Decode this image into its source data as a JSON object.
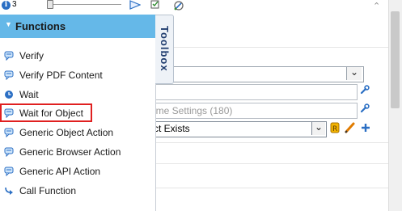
{
  "toolbar": {
    "info_count": "3"
  },
  "flyout": {
    "title": "Functions",
    "tab_label": "Toolbox",
    "items": [
      {
        "label": "Verify",
        "icon": "speech-bubble-icon"
      },
      {
        "label": "Verify PDF Content",
        "icon": "speech-bubble-icon"
      },
      {
        "label": "Wait",
        "icon": "clock-icon"
      },
      {
        "label": "Wait for Object",
        "icon": "speech-bubble-icon",
        "highlighted": true
      },
      {
        "label": "Generic Object Action",
        "icon": "speech-bubble-icon"
      },
      {
        "label": "Generic Browser Action",
        "icon": "speech-bubble-icon"
      },
      {
        "label": "Generic API Action",
        "icon": "speech-bubble-icon"
      },
      {
        "label": "Call Function",
        "icon": "curved-arrow-icon"
      }
    ]
  },
  "background_panel": {
    "runtime_settings_text": "ime Settings (180)",
    "select_value": "ct Exists"
  },
  "colors": {
    "header_bg": "#65b8e8",
    "highlight_border": "#e02020",
    "icon_blue": "#2b6fc4"
  }
}
